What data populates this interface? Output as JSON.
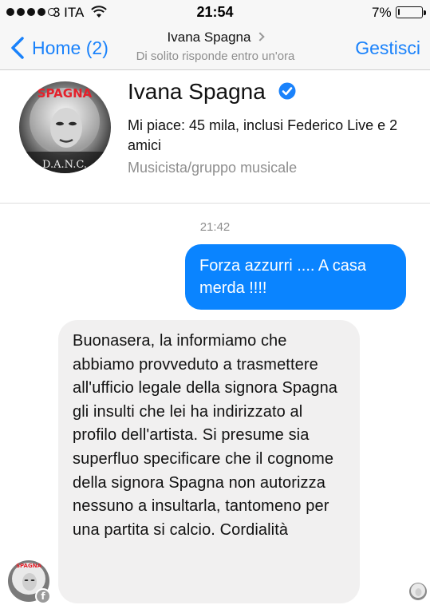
{
  "status_bar": {
    "carrier": "3 ITA",
    "time": "21:54",
    "battery_percent": "7%",
    "battery_level": 0.07,
    "signal_bars_filled": 4,
    "signal_bars_total": 5
  },
  "nav": {
    "back_label": "Home (2)",
    "title": "Ivana Spagna",
    "subtitle": "Di solito risponde entro un'ora",
    "manage_label": "Gestisci",
    "accent_color": "#1a82fb"
  },
  "profile": {
    "name": "Ivana Spagna",
    "likes": "Mi piace: 45 mila, inclusi Federico Live e 2 amici",
    "category": "Musicista/gruppo musicale",
    "avatar_text_top": "SPAGNA",
    "avatar_text_bottom": "D.A.N.C."
  },
  "conversation": {
    "timestamp": "21:42",
    "messages": [
      {
        "direction": "outgoing",
        "text": "Forza azzurri .... A casa merda !!!!"
      },
      {
        "direction": "incoming",
        "text": "Buonasera, la informiamo che abbiamo provveduto a trasmettere all'ufficio legale della signora Spagna gli insulti che lei ha indirizzato al profilo dell'artista. Si presume sia superfluo specificare che il cognome della signora Spagna non autorizza nessuno a insultarla, tantomeno per una partita si calcio. Cordialità"
      }
    ],
    "outgoing_color": "#0a84ff",
    "incoming_color": "#f1f0f0"
  },
  "icons": [
    "back-chevron-icon",
    "wifi-icon",
    "battery-icon",
    "verified-badge-icon",
    "facebook-icon"
  ]
}
